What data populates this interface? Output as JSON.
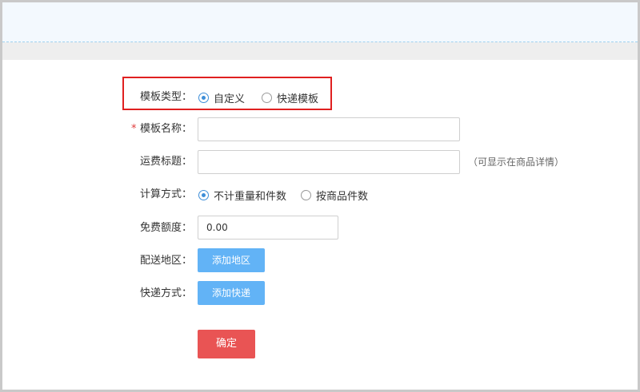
{
  "form": {
    "template_type": {
      "label": "模板类型：",
      "options": [
        "自定义",
        "快递模板"
      ],
      "selected_index": 0
    },
    "template_name": {
      "required_mark": "*",
      "label": "模板名称：",
      "value": ""
    },
    "shipping_title": {
      "label": "运费标题：",
      "value": "",
      "hint": "（可显示在商品详情）"
    },
    "billing_method": {
      "label": "计算方式：",
      "options": [
        "不计重量和件数",
        "按商品件数"
      ],
      "selected_index": 0
    },
    "free_amount": {
      "label": "免费额度：",
      "value": "0.00"
    },
    "delivery_area": {
      "label": "配送地区：",
      "button": "添加地区"
    },
    "express_method": {
      "label": "快递方式：",
      "button": "添加快递"
    },
    "submit": "确定"
  },
  "colors": {
    "accent_blue": "#62b3f6",
    "radio_blue": "#3e8ed8",
    "submit_red": "#e95454",
    "highlight_red": "#e02020",
    "required_red": "#e03c3c"
  }
}
